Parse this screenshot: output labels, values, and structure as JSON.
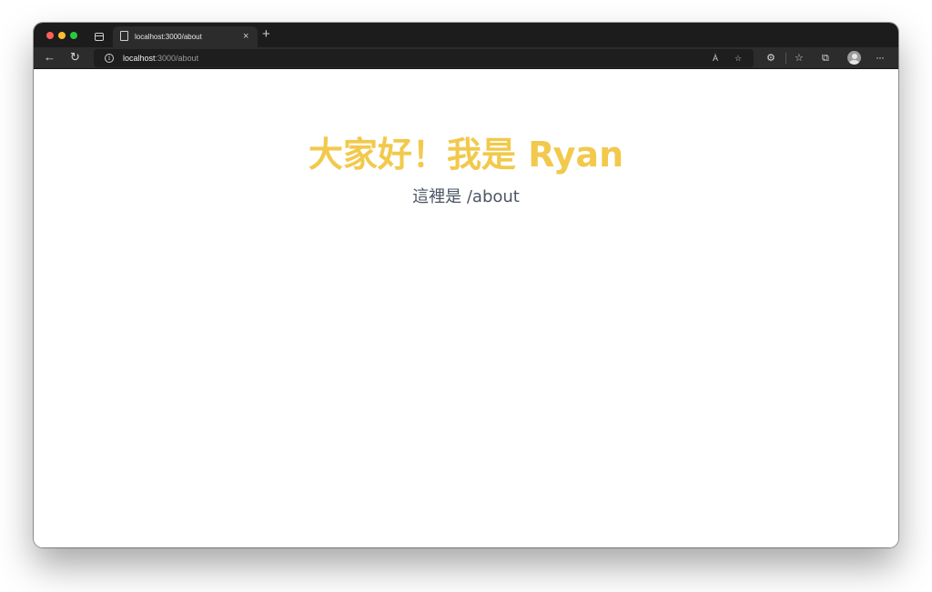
{
  "tab": {
    "title": "localhost:3000/about",
    "close": "×",
    "new_tab": "+"
  },
  "address": {
    "host": "localhost",
    "rest": ":3000/about"
  },
  "toolbar": {
    "back": "←",
    "refresh": "↻",
    "info": "i",
    "read_aloud": "A͑",
    "add_favorite": "☆",
    "extensions": "⚙",
    "favorites": "☆",
    "collections": "⧉",
    "more": "···"
  },
  "page": {
    "heading": "大家好！我是 Ryan",
    "subtitle": "這裡是 /about"
  },
  "colors": {
    "heading": "#f2c94c",
    "subtitle": "#4b5563",
    "chrome_dark": "#1c1c1c",
    "toolbar": "#2c2c2c"
  }
}
